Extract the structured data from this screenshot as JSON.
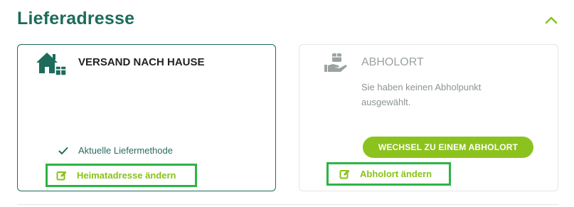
{
  "section": {
    "title": "Lieferadresse",
    "collapse_icon": "chevron-up-icon"
  },
  "home_delivery": {
    "title": "VERSAND NACH HAUSE",
    "icon": "house-with-package-icon",
    "status_label": "Aktuelle Liefermethode",
    "status_icon": "check-icon",
    "change_link_label": "Heimatadresse ändern",
    "change_link_icon": "edit-icon",
    "selected": true
  },
  "pickup": {
    "title": "ABHOLORT",
    "icon": "hand-with-package-icon",
    "description": "Sie haben keinen Abholpunkt ausgewählt.",
    "switch_button_label": "WECHSEL ZU EINEM ABHOLORT",
    "change_link_label": "Abholort ändern",
    "change_link_icon": "edit-icon",
    "selected": false
  },
  "colors": {
    "primary_teal": "#1d6b5b",
    "accent_lime": "#8cc21e",
    "highlight_green": "#2db345",
    "muted_text": "#8d9593"
  }
}
